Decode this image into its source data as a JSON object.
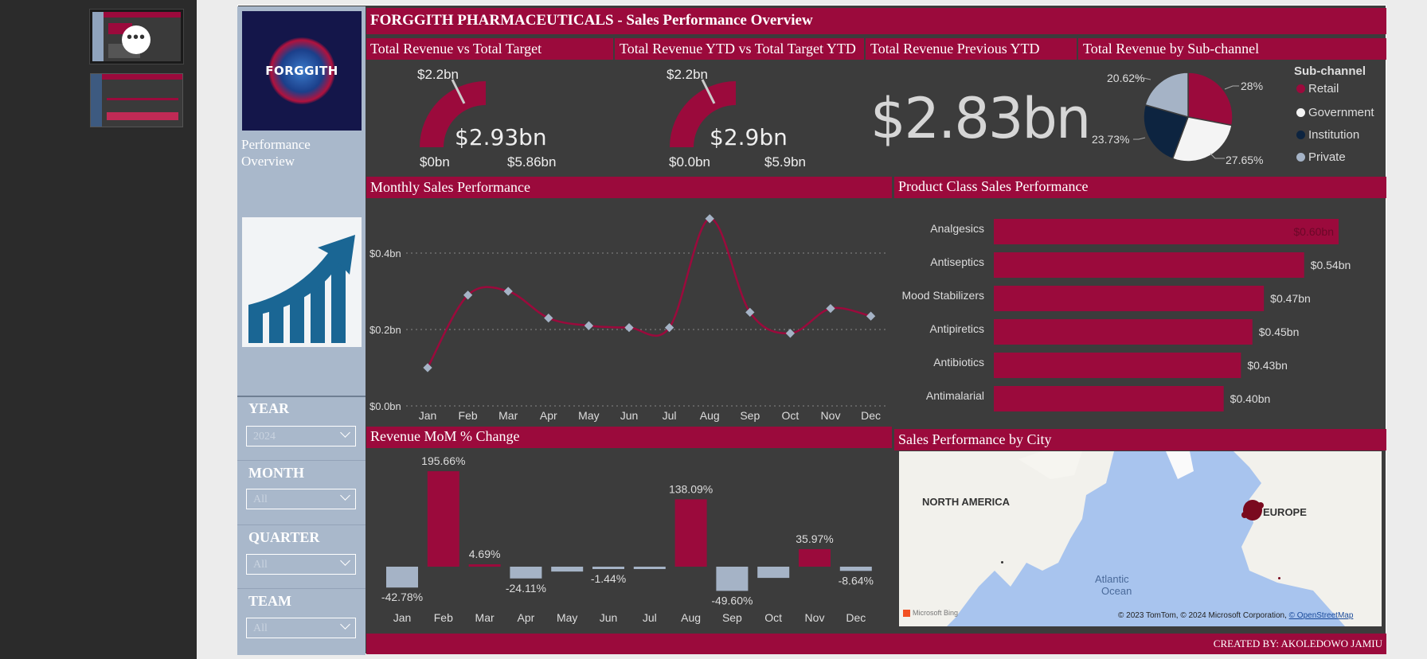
{
  "report": {
    "title": "FORGGITH PHARMACEUTICALS -  Sales Performance Overview",
    "footer": "CREATED BY: AKOLEDOWO JAMIU"
  },
  "sidebar": {
    "logo_text": "FORGGITH",
    "perf_label": "Performance Overview",
    "filters": [
      {
        "label": "YEAR",
        "value": "2024"
      },
      {
        "label": "MONTH",
        "value": "All"
      },
      {
        "label": "QUARTER",
        "value": "All"
      },
      {
        "label": "TEAM",
        "value": "All"
      }
    ]
  },
  "kpi": {
    "rev_vs_target": {
      "title": "Total Revenue vs Total Target",
      "value": "$2.93bn",
      "target": "$2.2bn",
      "min": "$0bn",
      "max": "$5.86bn",
      "fill": 0.5
    },
    "rev_ytd": {
      "title": "Total Revenue YTD vs Total Target YTD",
      "value": "$2.9bn",
      "target": "$2.2bn",
      "min": "$0.0bn",
      "max": "$5.9bn",
      "fill": 0.5
    },
    "prev_ytd": {
      "title": "Total Revenue Previous YTD",
      "value": "$2.83bn"
    },
    "subchannel": {
      "title": "Total Revenue by Sub-channel",
      "legend_title": "Sub-channel",
      "items": [
        {
          "name": "Retail",
          "pct": "28%",
          "value": 28,
          "color": "#9b0a3c"
        },
        {
          "name": "Government",
          "pct": "27.65%",
          "value": 27.65,
          "color": "#f4f4f4"
        },
        {
          "name": "Institution",
          "pct": "23.73%",
          "value": 23.73,
          "color": "#0d2440"
        },
        {
          "name": "Private",
          "pct": "20.62%",
          "value": 20.62,
          "color": "#a5b3c6"
        }
      ]
    }
  },
  "monthly": {
    "title": "Monthly Sales Performance",
    "chart_data": {
      "type": "line",
      "categories": [
        "Jan",
        "Feb",
        "Mar",
        "Apr",
        "May",
        "Jun",
        "Jul",
        "Aug",
        "Sep",
        "Oct",
        "Nov",
        "Dec"
      ],
      "values": [
        0.1,
        0.29,
        0.3,
        0.23,
        0.21,
        0.205,
        0.205,
        0.49,
        0.245,
        0.19,
        0.255,
        0.235
      ],
      "yticks": [
        "$0.0bn",
        "$0.2bn",
        "$0.4bn"
      ],
      "ylim": [
        0,
        0.5
      ]
    }
  },
  "product": {
    "title": "Product Class Sales Performance",
    "chart_data": {
      "type": "bar",
      "categories": [
        "Analgesics",
        "Antiseptics",
        "Mood Stabilizers",
        "Antipiretics",
        "Antibiotics",
        "Antimalarial"
      ],
      "values": [
        0.6,
        0.54,
        0.47,
        0.45,
        0.43,
        0.4
      ],
      "labels": [
        "$0.60bn",
        "$0.54bn",
        "$0.47bn",
        "$0.45bn",
        "$0.43bn",
        "$0.40bn"
      ]
    }
  },
  "mom": {
    "title": "Revenue MoM % Change",
    "chart_data": {
      "type": "bar",
      "categories": [
        "Jan",
        "Feb",
        "Mar",
        "Apr",
        "May",
        "Jun",
        "Jul",
        "Aug",
        "Sep",
        "Oct",
        "Nov",
        "Dec"
      ],
      "values": [
        -42.78,
        195.66,
        4.69,
        -24.11,
        -10.0,
        -1.44,
        -1.0,
        138.09,
        -49.6,
        -23.0,
        35.97,
        -8.64
      ],
      "labels": [
        "-42.78%",
        "195.66%",
        "4.69%",
        "-24.11%",
        "",
        "-1.44%",
        "",
        "138.09%",
        "-49.60%",
        "",
        "35.97%",
        "-8.64%"
      ]
    }
  },
  "city": {
    "title": "Sales Performance by City",
    "labels": {
      "na": "NORTH AMERICA",
      "eu": "EUROPE",
      "ocean1": "Atlantic",
      "ocean2": "Ocean"
    },
    "attribution": "© 2023 TomTom, © 2024 Microsoft Corporation,",
    "osm": "© OpenStreetMap",
    "bing": "Microsoft Bing"
  },
  "colors": {
    "accent": "#9b0a3c",
    "sidebar": "#a9b8cb",
    "neg": "#a5b3c6"
  },
  "icons": {
    "more": "more-dots-icon",
    "chevron": "chevron-down-icon"
  }
}
